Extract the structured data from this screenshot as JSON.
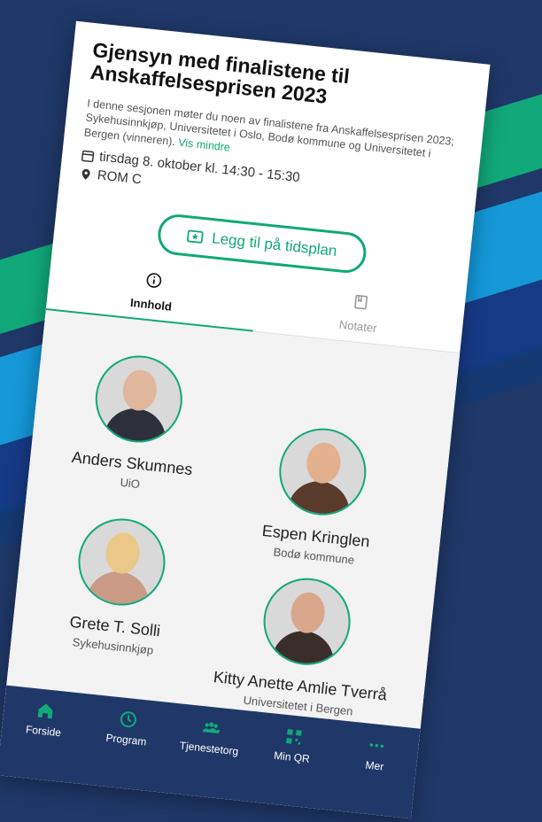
{
  "session": {
    "title": "Gjensyn med finalistene til Anskaffelsesprisen 2023",
    "description": "I denne sesjonen møter du noen av finalistene fra Anskaffelsesprisen 2023; Sykehusinnkjøp, Universitetet i Oslo, Bodø kommune og Universitetet i Bergen (vinneren).",
    "vis_mindre": "Vis mindre",
    "date_time": "tirsdag 8. oktober kl. 14:30 - 15:30",
    "room": "ROM C"
  },
  "schedule_button": {
    "label": "Legg til på tidsplan",
    "icon": "ticket-star-icon"
  },
  "tabs": [
    {
      "label": "Innhold",
      "icon": "info-circle-icon",
      "active": true
    },
    {
      "label": "Notater",
      "icon": "notepad-icon",
      "active": false
    }
  ],
  "speakers": [
    {
      "name": "Anders Skumnes",
      "affiliation": "UiO"
    },
    {
      "name": "Espen Kringlen",
      "affiliation": "Bodø kommune"
    },
    {
      "name": "Grete T. Solli",
      "affiliation": "Sykehusinnkjøp"
    },
    {
      "name": "Kitty Anette Amlie Tverrå",
      "affiliation": "Universitetet i Bergen"
    }
  ],
  "nav": [
    {
      "label": "Forside",
      "icon": "home-icon"
    },
    {
      "label": "Program",
      "icon": "clock-icon"
    },
    {
      "label": "Tjenestetorg",
      "icon": "people-icon"
    },
    {
      "label": "Min QR",
      "icon": "qr-code-icon"
    },
    {
      "label": "Mer",
      "icon": "more-dots-icon"
    }
  ],
  "colors": {
    "accent": "#11a97a",
    "navy": "#1f3868",
    "nav_active": "#11a97a"
  }
}
